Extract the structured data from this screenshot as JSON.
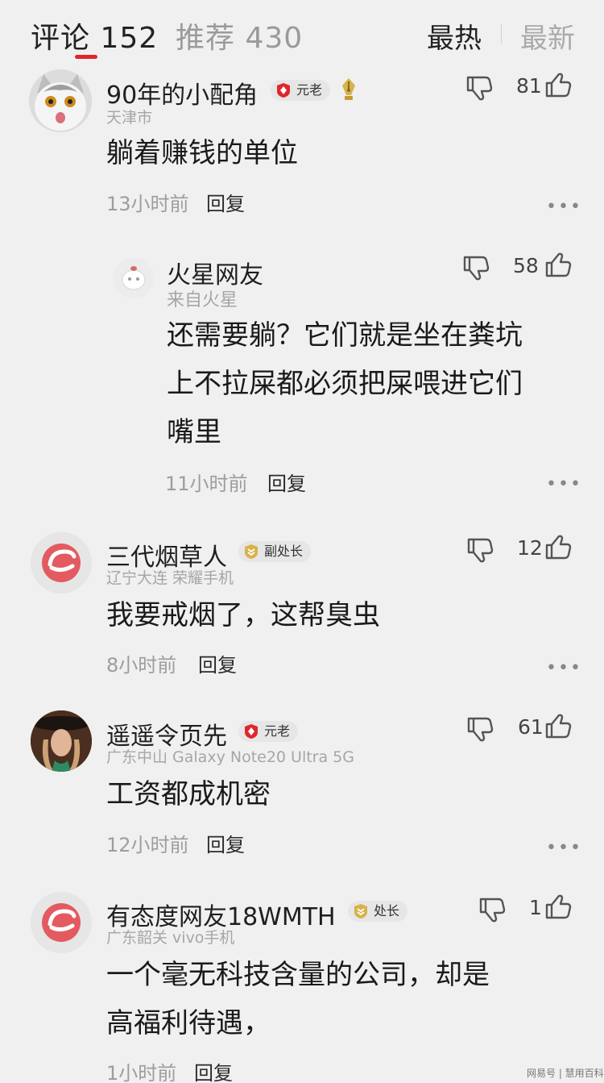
{
  "tabs": {
    "comments_label": "评论 152",
    "recommend_label": "推荐 430",
    "sort_hot": "最热",
    "sort_new": "最新"
  },
  "comments": [
    {
      "username": "90年的小配角",
      "badge": "元老",
      "location": "天津市",
      "content_lines": [
        "躺着赚钱的单位"
      ],
      "time": "13小时前",
      "reply": "回复",
      "likes": "81"
    },
    {
      "username": "火星网友",
      "location": "来自火星",
      "content_lines": [
        "还需要躺？它们就是坐在粪坑",
        "上不拉屎都必须把屎喂进它们",
        "嘴里"
      ],
      "time": "11小时前",
      "reply": "回复",
      "likes": "58"
    },
    {
      "username": "三代烟草人",
      "badge": "副处长",
      "location": "辽宁大连   荣耀手机",
      "content_lines": [
        "我要戒烟了，这帮臭虫"
      ],
      "time": "8小时前",
      "reply": "回复",
      "likes": "12"
    },
    {
      "username": "遥遥令页先",
      "badge": "元老",
      "location": "广东中山   Galaxy Note20 Ultra 5G",
      "content_lines": [
        "工资都成机密"
      ],
      "time": "12小时前",
      "reply": "回复",
      "likes": "61"
    },
    {
      "username": "有态度网友18WMTH",
      "badge": "处长",
      "location": "广东韶关   vivo手机",
      "content_lines": [
        "一个毫无科技含量的公司，却是",
        "高福利待遇，"
      ],
      "time": "1小时前",
      "reply": "回复",
      "likes": "1"
    }
  ],
  "more_glyph": "•••",
  "watermark": "网易号 | 慧用百科",
  "icons": [
    "dislike-icon",
    "like-icon",
    "more-icon",
    "veteran-badge-icon",
    "rank-badge-icon",
    "pen-medal-icon"
  ],
  "colors": {
    "accent": "#e0262b",
    "background": "#f0f0f0",
    "badge_gold": "#d8b24a"
  }
}
